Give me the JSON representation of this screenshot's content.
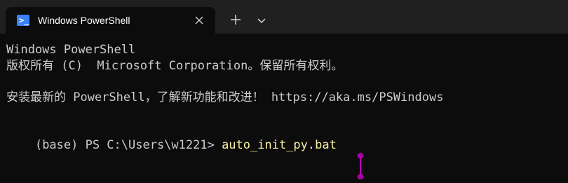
{
  "tab": {
    "title": "Windows PowerShell"
  },
  "terminal": {
    "lines": [
      "Windows PowerShell",
      "版权所有 (C)  Microsoft Corporation。保留所有权利。",
      "",
      "安装最新的 PowerShell，了解新功能和改进！ https://aka.ms/PSWindows",
      ""
    ],
    "prompt": "(base) PS C:\\Users\\w1221> ",
    "command": "auto_init_py.bat"
  },
  "colors": {
    "accent": "#3b82f6",
    "command": "#f9f1a5",
    "caret": "#b000b0",
    "text": "#cccccc"
  },
  "icons": {
    "tab_icon": "powershell-icon",
    "close": "close-icon",
    "new_tab": "plus-icon",
    "dropdown": "chevron-down-icon",
    "caret": "text-caret-icon"
  }
}
